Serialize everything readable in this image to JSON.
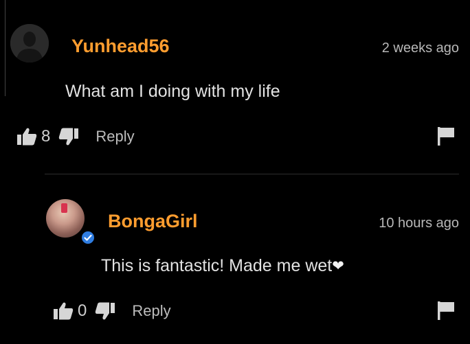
{
  "comments": [
    {
      "username": "Yunhead56",
      "timestamp": "2 weeks ago",
      "text": "What am I doing with my life",
      "likes": "8",
      "reply_label": "Reply"
    },
    {
      "username": "BongaGirl",
      "timestamp": "10 hours ago",
      "text": "This is fantastic! Made me wet",
      "likes": "0",
      "reply_label": "Reply",
      "verified": true
    }
  ],
  "colors": {
    "background": "#000000",
    "username": "#ff9d2f",
    "verified_badge": "#2f7de1"
  },
  "icons": [
    "user-icon",
    "verified-icon",
    "thumbs-up-icon",
    "thumbs-down-icon",
    "flag-icon",
    "heart-icon"
  ]
}
